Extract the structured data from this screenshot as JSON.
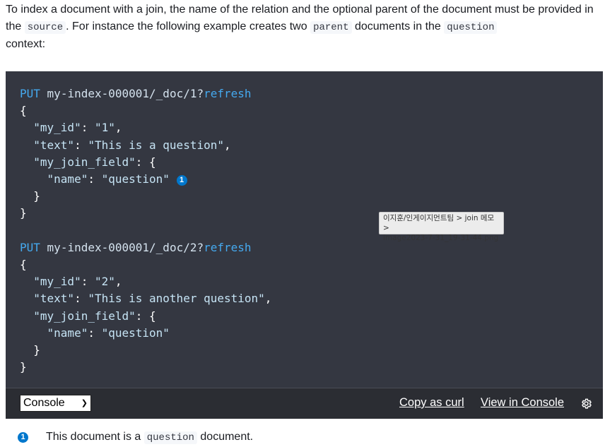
{
  "intro": {
    "part1": "To index a document with a join, the name of the relation and the optional parent of the document must be provided in the",
    "code1": "source",
    "part2": ". For instance the following example creates two",
    "code2": "parent",
    "part3": "documents in the",
    "code3": "question",
    "part4": "context:"
  },
  "code": {
    "req1": {
      "method": "PUT",
      "path": "my-index-000001/_doc/1?",
      "param": "refresh"
    },
    "req1_body": {
      "open": "{",
      "id_key": "\"my_id\"",
      "id_val": "\"1\"",
      "text_key": "\"text\"",
      "text_val": "\"This is a question\"",
      "join_key": "\"my_join_field\"",
      "name_key": "\"name\"",
      "name_val": "\"question\"",
      "callout": "1",
      "inner_close": "}",
      "close": "}"
    },
    "req2": {
      "method": "PUT",
      "path": "my-index-000001/_doc/2?",
      "param": "refresh"
    },
    "req2_body": {
      "open": "{",
      "id_key": "\"my_id\"",
      "id_val": "\"2\"",
      "text_key": "\"text\"",
      "text_val": "\"This is another question\"",
      "join_key": "\"my_join_field\"",
      "name_key": "\"name\"",
      "name_val": "\"question\"",
      "inner_close": "}",
      "close": "}"
    }
  },
  "tooltip": {
    "line1": "이지훈/인게이지먼트팀 > join 메모 >",
    "line2": "image2023-7-31_19-31-44.png"
  },
  "toolbar": {
    "select_value": "Console",
    "copy_label": "Copy as curl",
    "view_label": "View in Console",
    "settings_icon": "gear-icon"
  },
  "footnote": {
    "callout": "1",
    "before": "This document is a",
    "code": "question",
    "after": "document."
  }
}
